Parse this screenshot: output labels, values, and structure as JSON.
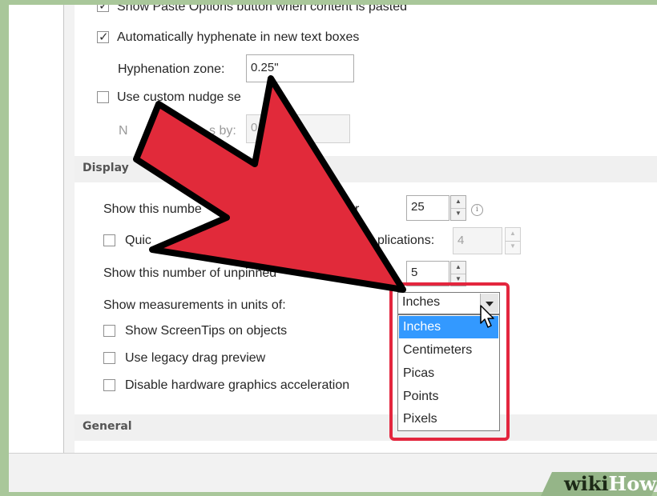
{
  "options": {
    "paste_options_label": "Show Paste Options button when content is pasted",
    "paste_options_checked": true,
    "hyphenate_label": "Automatically hyphenate in new text boxes",
    "hyphenate_checked": true,
    "hyphenation_zone_label": "Hyphenation zone:",
    "hyphenation_zone_value": "0.25\"",
    "custom_nudge_label": "Use custom nudge se",
    "custom_nudge_checked": false,
    "nudge_by_label_start": "N",
    "nudge_by_label_end": "s by:",
    "nudge_by_value": "0"
  },
  "display": {
    "section_title": "Display",
    "recent_docs_label_start": "Show this numbe",
    "recent_docs_label_end": "r",
    "recent_docs_value": "25",
    "quick_access_label_start": "Quic",
    "quick_access_label_end": "plications:",
    "quick_access_checked": false,
    "quick_access_value": "4",
    "unpinned_label": "Show this number of unpinned",
    "unpinned_value": "5",
    "units_label": "Show measurements in units of:",
    "units_selected": "Inches",
    "units_options": [
      "Inches",
      "Centimeters",
      "Picas",
      "Points",
      "Pixels"
    ],
    "screentips_label": "Show ScreenTips on objects",
    "screentips_checked": false,
    "legacy_drag_label": "Use legacy drag preview",
    "legacy_drag_checked": false,
    "hw_accel_label": "Disable hardware graphics acceleration",
    "hw_accel_checked": false
  },
  "general": {
    "section_title": "General"
  },
  "watermark": {
    "wiki": "wiki",
    "how": "How"
  },
  "colors": {
    "highlight": "#3399ff",
    "callout_red": "#e3263e",
    "frame_green": "#a9c79a"
  },
  "icons": {
    "annotation_arrow": "red-pointer-arrow-icon",
    "mouse_cursor": "mouse-pointer-icon",
    "info": "info-icon"
  }
}
